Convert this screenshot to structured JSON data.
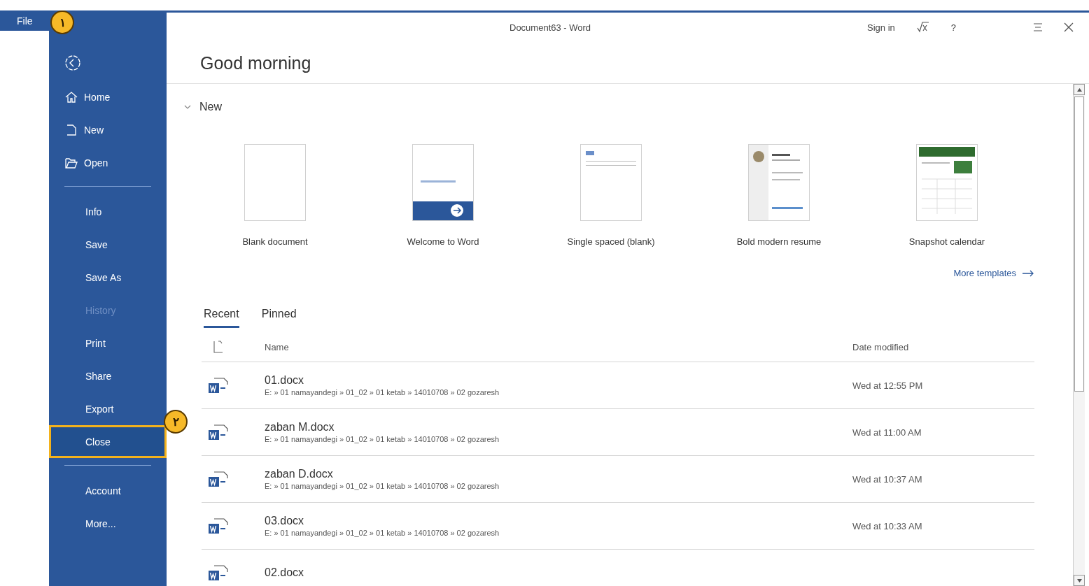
{
  "file_tab": {
    "label": "File",
    "callout": "۱"
  },
  "window": {
    "title": "Document63 - Word",
    "sign_in": "Sign in",
    "help": "?"
  },
  "sidebar": {
    "items": [
      {
        "kind": "back"
      },
      {
        "kind": "icon",
        "label": "Home",
        "disabled": false,
        "selected": false
      },
      {
        "kind": "icon",
        "label": "New",
        "disabled": false,
        "selected": false
      },
      {
        "kind": "icon",
        "label": "Open",
        "disabled": false,
        "selected": false
      },
      {
        "kind": "divider"
      },
      {
        "kind": "text",
        "label": "Info",
        "disabled": false,
        "selected": false
      },
      {
        "kind": "text",
        "label": "Save",
        "disabled": false,
        "selected": false
      },
      {
        "kind": "text",
        "label": "Save As",
        "disabled": false,
        "selected": false
      },
      {
        "kind": "text",
        "label": "History",
        "disabled": true,
        "selected": false
      },
      {
        "kind": "text",
        "label": "Print",
        "disabled": false,
        "selected": false
      },
      {
        "kind": "text",
        "label": "Share",
        "disabled": false,
        "selected": false
      },
      {
        "kind": "text",
        "label": "Export",
        "disabled": false,
        "selected": false
      },
      {
        "kind": "text",
        "label": "Close",
        "disabled": false,
        "selected": true,
        "callout": "۲"
      },
      {
        "kind": "divider"
      },
      {
        "kind": "text",
        "label": "Account",
        "disabled": false,
        "selected": false
      },
      {
        "kind": "text",
        "label": "More...",
        "disabled": false,
        "selected": false
      }
    ]
  },
  "greeting": "Good morning",
  "new_section": {
    "title": "New",
    "expanded": true,
    "templates": [
      {
        "kind": "blank",
        "label": "Blank document"
      },
      {
        "kind": "welcome",
        "label": "Welcome to Word"
      },
      {
        "kind": "lines",
        "label": "Single spaced (blank)"
      },
      {
        "kind": "resume",
        "label": "Bold modern resume"
      },
      {
        "kind": "calendar",
        "label": "Snapshot calendar"
      }
    ],
    "more": "More templates"
  },
  "tabs": [
    {
      "label": "Recent",
      "selected": true
    },
    {
      "label": "Pinned",
      "selected": false
    }
  ],
  "table": {
    "columns": [
      "Name",
      "Date modified"
    ],
    "rows": [
      {
        "name": "01.docx",
        "path": "E: » 01 namayandegi » 01_02 » 01 ketab » 14010708 » 02 gozaresh",
        "date": "Wed at 12:55 PM"
      },
      {
        "name": "zaban M.docx",
        "path": "E: » 01 namayandegi » 01_02 » 01 ketab » 14010708 » 02 gozaresh",
        "date": "Wed at 11:00 AM"
      },
      {
        "name": "zaban D.docx",
        "path": "E: » 01 namayandegi » 01_02 » 01 ketab » 14010708 » 02 gozaresh",
        "date": "Wed at 10:37 AM"
      },
      {
        "name": "03.docx",
        "path": "E: » 01 namayandegi » 01_02 » 01 ketab » 14010708 » 02 gozaresh",
        "date": "Wed at 10:33 AM"
      },
      {
        "name": "02.docx"
      }
    ]
  }
}
